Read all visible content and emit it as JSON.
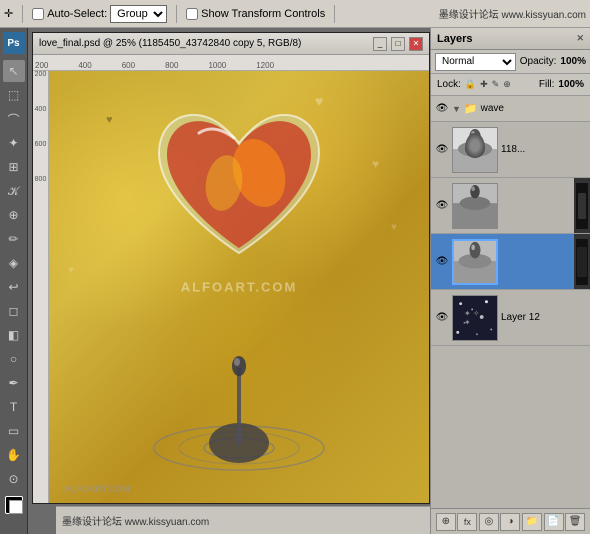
{
  "app": {
    "title": "Photoshop",
    "ps_logo": "Ps"
  },
  "toolbar": {
    "auto_select_label": "Auto-Select:",
    "group_label": "Group",
    "show_transform_label": "Show Transform Controls",
    "watermark": "墨缘设计论坛 www.kissyuan.com"
  },
  "canvas_window": {
    "title": "love_final.psd @ 25% (1185450_43742840 copy 5, RGB/8)",
    "ruler_ticks_h": [
      "200",
      "400",
      "600",
      "800",
      "1000",
      "1200"
    ],
    "ruler_ticks_v": [
      "200",
      "400",
      "600",
      "800"
    ],
    "watermark": "ALFOART.COM"
  },
  "layers_panel": {
    "title": "Layers",
    "close_label": "✕",
    "blend_mode": "Normal",
    "opacity_label": "Opacity:",
    "opacity_value": "100%",
    "lock_label": "Lock:",
    "fill_label": "Fill:",
    "fill_value": "100%",
    "group_name": "wave",
    "layers": [
      {
        "id": "layer1",
        "name": "118...",
        "sub": "",
        "thumb_type": "waterdrop",
        "active": false,
        "has_right_panel": false
      },
      {
        "id": "layer2",
        "name": "",
        "sub": "",
        "thumb_type": "waterdrop2",
        "active": false,
        "has_right_panel": true
      },
      {
        "id": "layer3",
        "name": "",
        "sub": "",
        "thumb_type": "waterdrop3",
        "active": true,
        "has_right_panel": true
      },
      {
        "id": "layer4",
        "name": "Layer 12",
        "sub": "",
        "thumb_type": "stars",
        "active": false,
        "has_right_panel": false
      }
    ]
  },
  "panel_buttons": [
    "⊕",
    "fx",
    "◎",
    "🗑",
    "📄",
    "📁"
  ],
  "bottom_bar": {
    "text": "墨缘设计论坛  www.kissyuan.com"
  }
}
